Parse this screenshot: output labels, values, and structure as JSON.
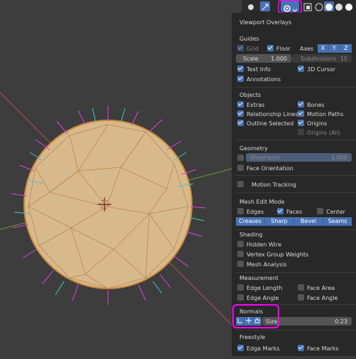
{
  "panel": {
    "title": "Viewport Overlays",
    "guides": {
      "header": "Guides",
      "grid": {
        "label": "Grid",
        "checked": true
      },
      "floor": {
        "label": "Floor",
        "checked": true
      },
      "axes_label": "Axes",
      "axes": [
        "X",
        "Y",
        "Z"
      ],
      "scale_label": "Scale",
      "scale_value": "1.000",
      "subdivisions_label": "Subdivisions",
      "subdivisions_value": "10",
      "text_info": {
        "label": "Text Info",
        "checked": true
      },
      "cursor_3d": {
        "label": "3D Cursor",
        "checked": true
      },
      "annotations": {
        "label": "Annotations",
        "checked": true
      }
    },
    "objects": {
      "header": "Objects",
      "extras": {
        "label": "Extras",
        "checked": true
      },
      "bones": {
        "label": "Bones",
        "checked": true
      },
      "relationship_lines": {
        "label": "Relationship Lines",
        "checked": true
      },
      "motion_paths": {
        "label": "Motion Paths",
        "checked": true
      },
      "outline_selected": {
        "label": "Outline Selected",
        "checked": true
      },
      "origins": {
        "label": "Origins",
        "checked": true
      },
      "origins_all": {
        "label": "Origins (All)",
        "checked": false
      }
    },
    "geometry": {
      "header": "Geometry",
      "wireframe_label": "Wireframe",
      "wireframe_value": "1.000",
      "face_orientation": {
        "label": "Face Orientation",
        "checked": false
      },
      "motion_tracking": {
        "label": "Motion Tracking",
        "checked": false
      }
    },
    "mesh_edit": {
      "header": "Mesh Edit Mode",
      "edges": {
        "label": "Edges",
        "checked": false
      },
      "faces": {
        "label": "Faces",
        "checked": true
      },
      "center": {
        "label": "Center",
        "checked": false
      },
      "buttons": [
        "Creases",
        "Sharp",
        "Bevel",
        "Seams"
      ]
    },
    "shading": {
      "header": "Shading",
      "hidden_wire": {
        "label": "Hidden Wire",
        "checked": false
      },
      "vertex_group_weights": {
        "label": "Vertex Group Weights",
        "checked": false
      },
      "mesh_analysis": {
        "label": "Mesh Analysis",
        "checked": false
      }
    },
    "measurement": {
      "header": "Measurement",
      "edge_length": {
        "label": "Edge Length",
        "checked": false
      },
      "face_area": {
        "label": "Face Area",
        "checked": false
      },
      "edge_angle": {
        "label": "Edge Angle",
        "checked": false
      },
      "face_angle": {
        "label": "Face Angle",
        "checked": false
      }
    },
    "normals": {
      "header": "Normals",
      "size_label": "Size",
      "size_value": "0.23"
    },
    "freestyle": {
      "header": "Freestyle",
      "edge_marks": {
        "label": "Edge Marks",
        "checked": true
      },
      "face_marks": {
        "label": "Face Marks",
        "checked": true
      }
    }
  },
  "colors": {
    "accent": "#4772b3",
    "panel_bg": "#282828",
    "viewport_bg": "#3d3d3d",
    "highlight": "#ff00ff"
  },
  "icons": [
    "view-gizmo-icon",
    "navigate-icon",
    "overlay-icon",
    "xray-icon",
    "wireframe-shading-icon",
    "solid-shading-icon",
    "material-shading-icon",
    "rendered-shading-icon"
  ]
}
